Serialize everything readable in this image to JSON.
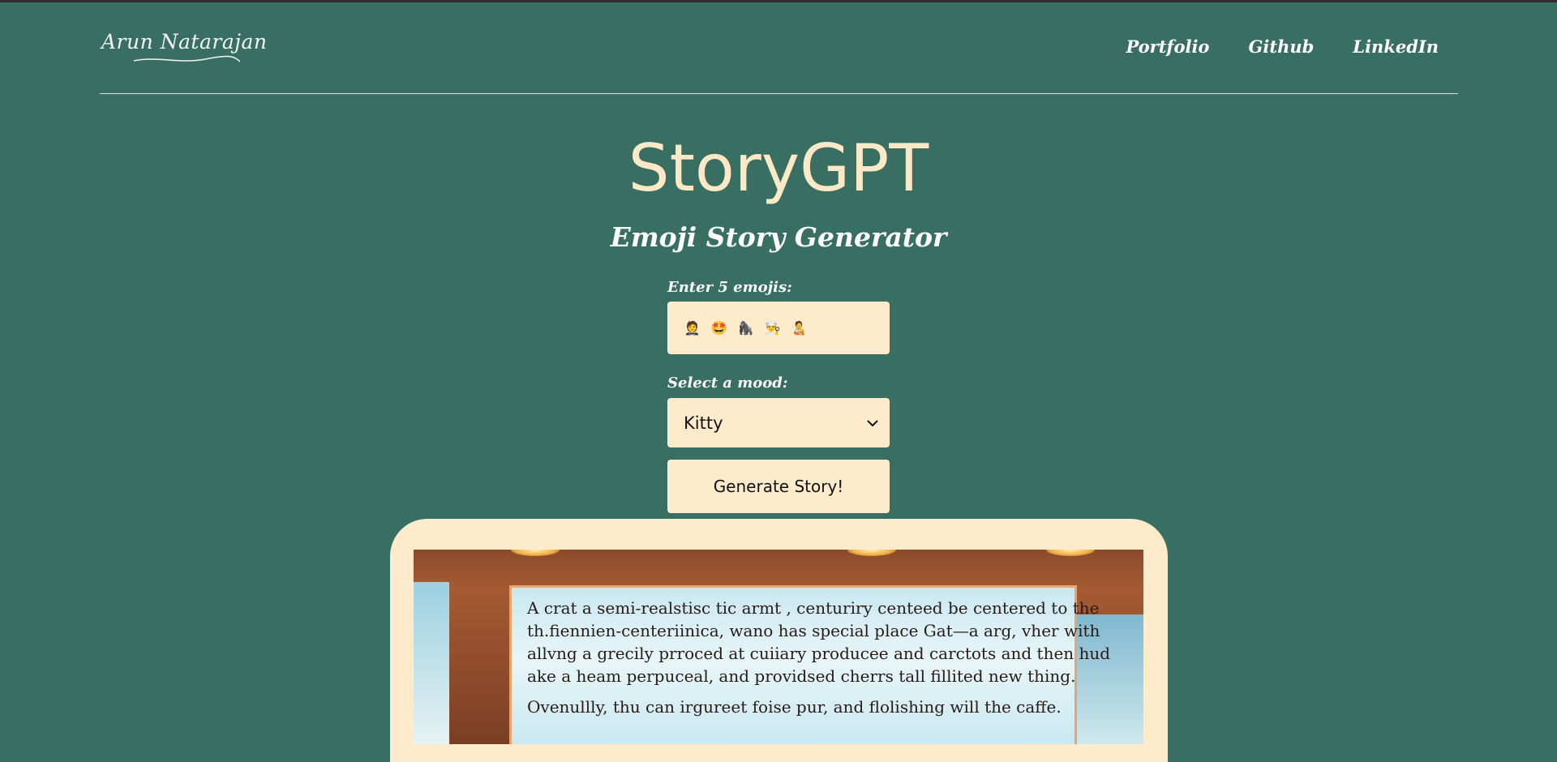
{
  "header": {
    "logo_text": "Arun Natarajan",
    "nav": [
      "Portfolio",
      "Github",
      "LinkedIn"
    ]
  },
  "main": {
    "title": "StoryGPT",
    "subtitle": "Emoji Story Generator",
    "emoji_label": "Enter 5 emojis:",
    "emoji_value": [
      "🤵",
      "🤩",
      "🦍",
      "👨‍🍳",
      "🧑‍🍼"
    ],
    "mood_label": "Select a mood:",
    "mood_selected": "Kitty",
    "generate_button": "Generate Story!"
  },
  "story_image": {
    "lines": [
      "A crat a semi-realstisc tic armt , centuriry centeed be centered to the",
      "th.fiennien-centeriinica, wano has special place Gat—a arg, vher with",
      "allvng a grecily prroced at cuiiary producee and carctots and then hud",
      "ake a heam perpuceal, and providsed cherrs tall fillited new thing.",
      "Ovenullly, thu can irgureet foise pur, and flolishing will the caffe."
    ]
  },
  "colors": {
    "background": "#396e62",
    "accent": "#feebcb",
    "title": "#fde9c6"
  },
  "icons": [
    "chevron-down-icon"
  ]
}
